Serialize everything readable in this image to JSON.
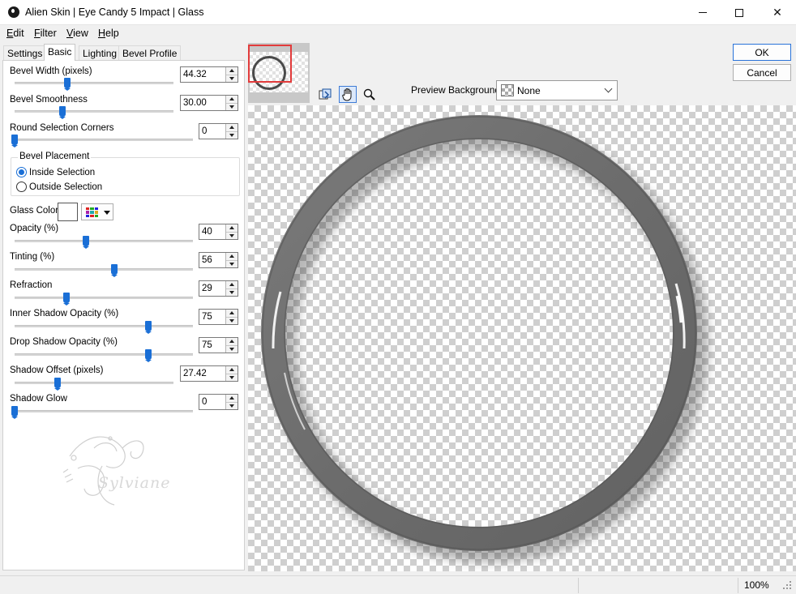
{
  "window": {
    "title": "Alien Skin | Eye Candy 5 Impact | Glass",
    "min_glyph": "",
    "close_glyph": "✕"
  },
  "menu": [
    {
      "key": "E",
      "rest": "dit"
    },
    {
      "key": "F",
      "rest": "ilter"
    },
    {
      "key": "V",
      "rest": "iew"
    },
    {
      "key": "H",
      "rest": "elp"
    }
  ],
  "tabs": [
    "Settings",
    "Basic",
    "Lighting",
    "Bevel Profile"
  ],
  "active_tab": "Basic",
  "controls": {
    "bevel_width": {
      "label": "Bevel Width (pixels)",
      "value": "44.32",
      "level": 0.33
    },
    "bevel_smoothness": {
      "label": "Bevel Smoothness",
      "value": "30.00",
      "level": 0.3
    },
    "round_corners": {
      "label": "Round Selection Corners",
      "value": "0",
      "level": 0.0
    },
    "bevel_placement": {
      "title": "Bevel Placement",
      "options": [
        "Inside Selection",
        "Outside Selection"
      ],
      "selected": "Inside Selection"
    },
    "glass_color": {
      "label": "Glass Color",
      "color": "#ffffff"
    },
    "opacity": {
      "label": "Opacity (%)",
      "value": "40",
      "level": 0.4
    },
    "tinting": {
      "label": "Tinting (%)",
      "value": "56",
      "level": 0.56
    },
    "refraction": {
      "label": "Refraction",
      "value": "29",
      "level": 0.29
    },
    "inner_shadow_opacity": {
      "label": "Inner Shadow Opacity (%)",
      "value": "75",
      "level": 0.75
    },
    "drop_shadow_opacity": {
      "label": "Drop Shadow Opacity (%)",
      "value": "75",
      "level": 0.75
    },
    "shadow_offset": {
      "label": "Shadow Offset (pixels)",
      "value": "27.42",
      "level": 0.27
    },
    "shadow_glow": {
      "label": "Shadow Glow",
      "value": "0",
      "level": 0.0
    }
  },
  "watermark_text": "Sylviane",
  "preview": {
    "background_label": "Preview Background:",
    "background_value": "None"
  },
  "buttons": {
    "ok": "OK",
    "cancel": "Cancel"
  },
  "status": {
    "zoom": "100%"
  },
  "colors": {
    "accent": "#1a6fd6",
    "ring": "#6f6f6f",
    "nav_rect": "#e23b3b"
  }
}
